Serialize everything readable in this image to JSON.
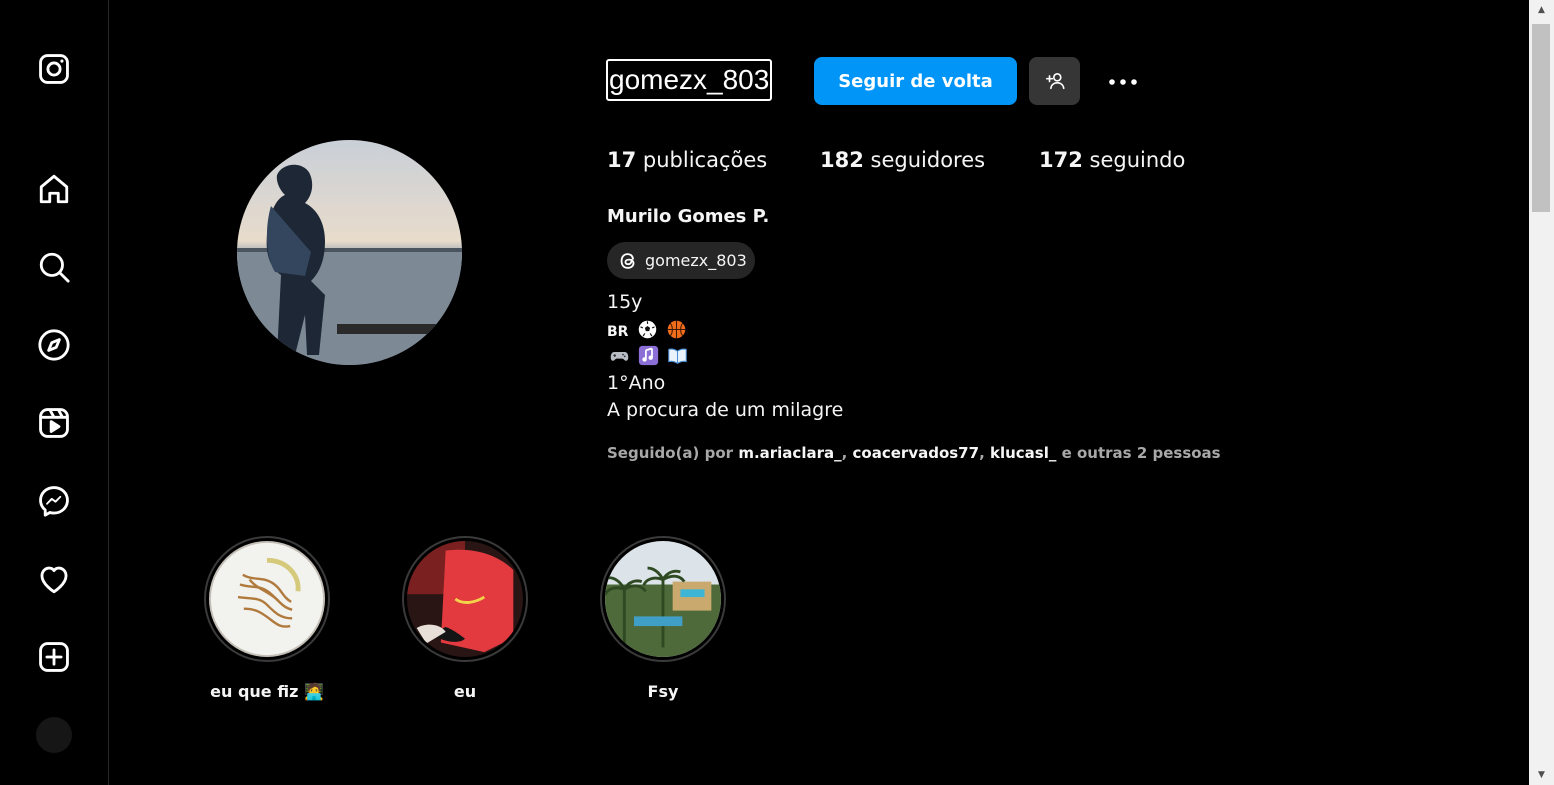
{
  "sidebar": {
    "items": [
      {
        "name": "instagram-logo-icon"
      },
      {
        "name": "home-icon"
      },
      {
        "name": "search-icon"
      },
      {
        "name": "explore-icon"
      },
      {
        "name": "reels-icon"
      },
      {
        "name": "messenger-icon"
      },
      {
        "name": "notifications-heart-icon"
      },
      {
        "name": "create-plus-icon"
      }
    ]
  },
  "profile": {
    "username": "gomezx_803",
    "follow_back_label": "Seguir de volta",
    "stats": {
      "posts_count": "17",
      "posts_label": "publicações",
      "followers_count": "182",
      "followers_label": "seguidores",
      "following_count": "172",
      "following_label": "seguindo"
    },
    "full_name": "Murilo Gomes P.",
    "threads_handle": "gomezx_803",
    "bio": {
      "line1": "15y",
      "line2_text": "BR",
      "line4": "1°Ano",
      "line5": "A procura de um milagre"
    },
    "followed_by": {
      "prefix": "Seguido(a) por",
      "users": [
        "m.ariaclara_",
        "coacervados77",
        "klucasl_"
      ],
      "sep1": ", ",
      "sep2": ", ",
      "suffix": "e outras 2 pessoas"
    }
  },
  "highlights": [
    {
      "label": "eu que fiz 🧑‍💻"
    },
    {
      "label": "eu"
    },
    {
      "label": "Fsy"
    }
  ],
  "colors": {
    "background": "#000000",
    "accent": "#0095f6",
    "secondary_button": "#363636",
    "muted_text": "#a8a8a8"
  }
}
